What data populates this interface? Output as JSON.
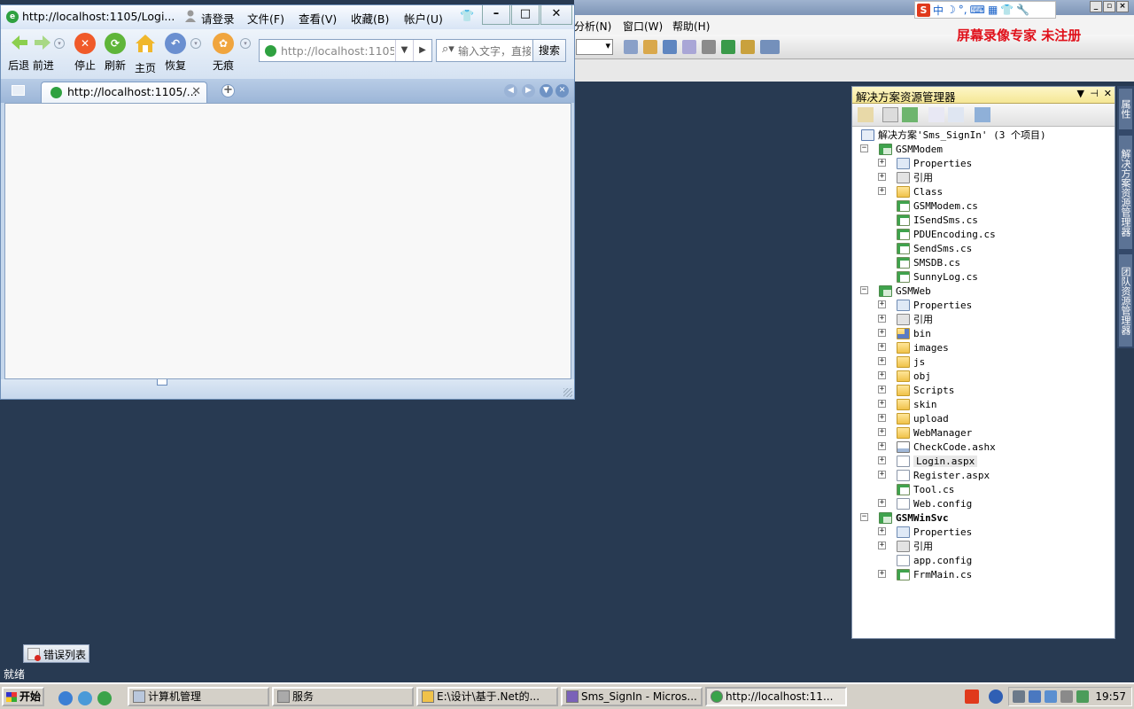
{
  "vs": {
    "menu": [
      "分析(N)",
      "窗口(W)",
      "帮助(H)"
    ],
    "status": "就绪",
    "error_tab": "错误列表"
  },
  "recorder_text": "屏幕录像专家  未注册",
  "ime_text": "中",
  "browser": {
    "title": "http://localhost:1105/Logi...",
    "login": "请登录",
    "menus": [
      "文件(F)",
      "查看(V)",
      "收藏(B)",
      "帐户(U)"
    ],
    "nav": {
      "back_fwd": "后退 前进",
      "stop": "停止",
      "refresh": "刷新",
      "home": "主页",
      "restore": "恢复",
      "incognito": "无痕"
    },
    "address_value": "http://localhost:1105",
    "search_placeholder": "输入文字，直接",
    "search_button": "搜索",
    "tab_title": "http://localhost:1105/..."
  },
  "solution_explorer": {
    "title": "解决方案资源管理器",
    "solution": "解决方案'Sms_SignIn' (3 个项目)",
    "items": [
      {
        "label": "GSMModem",
        "icon": "project-icon",
        "level": 0,
        "exp": "-"
      },
      {
        "label": "Properties",
        "icon": "properties-icon",
        "level": 1,
        "exp": "+"
      },
      {
        "label": "引用",
        "icon": "references-icon",
        "level": 1,
        "exp": "+"
      },
      {
        "label": "Class",
        "icon": "folder-icon",
        "level": 1,
        "exp": "+"
      },
      {
        "label": "GSMModem.cs",
        "icon": "cs-file-icon",
        "level": 1,
        "exp": ""
      },
      {
        "label": "ISendSms.cs",
        "icon": "cs-file-icon",
        "level": 1,
        "exp": ""
      },
      {
        "label": "PDUEncoding.cs",
        "icon": "cs-file-icon",
        "level": 1,
        "exp": ""
      },
      {
        "label": "SendSms.cs",
        "icon": "cs-file-icon",
        "level": 1,
        "exp": ""
      },
      {
        "label": "SMSDB.cs",
        "icon": "cs-file-icon",
        "level": 1,
        "exp": ""
      },
      {
        "label": "SunnyLog.cs",
        "icon": "cs-file-icon",
        "level": 1,
        "exp": ""
      },
      {
        "label": "GSMWeb",
        "icon": "web-project-icon",
        "level": 0,
        "exp": "-"
      },
      {
        "label": "Properties",
        "icon": "properties-icon",
        "level": 1,
        "exp": "+"
      },
      {
        "label": "引用",
        "icon": "references-icon",
        "level": 1,
        "exp": "+"
      },
      {
        "label": "bin",
        "icon": "bin-folder-icon",
        "level": 1,
        "exp": "+"
      },
      {
        "label": "images",
        "icon": "folder-icon",
        "level": 1,
        "exp": "+"
      },
      {
        "label": "js",
        "icon": "folder-icon",
        "level": 1,
        "exp": "+"
      },
      {
        "label": "obj",
        "icon": "folder-icon",
        "level": 1,
        "exp": "+"
      },
      {
        "label": "Scripts",
        "icon": "folder-icon",
        "level": 1,
        "exp": "+"
      },
      {
        "label": "skin",
        "icon": "folder-icon",
        "level": 1,
        "exp": "+"
      },
      {
        "label": "upload",
        "icon": "folder-icon",
        "level": 1,
        "exp": "+"
      },
      {
        "label": "WebManager",
        "icon": "folder-icon",
        "level": 1,
        "exp": "+"
      },
      {
        "label": "CheckCode.ashx",
        "icon": "handler-file-icon",
        "level": 1,
        "exp": "+"
      },
      {
        "label": "Login.aspx",
        "icon": "aspx-page-icon",
        "level": 1,
        "exp": "+",
        "selected": true
      },
      {
        "label": "Register.aspx",
        "icon": "aspx-page-icon",
        "level": 1,
        "exp": "+"
      },
      {
        "label": "Tool.cs",
        "icon": "cs-file-icon",
        "level": 1,
        "exp": ""
      },
      {
        "label": "Web.config",
        "icon": "config-file-icon",
        "level": 1,
        "exp": "+"
      },
      {
        "label": "GSMWinSvc",
        "icon": "project-icon",
        "level": 0,
        "exp": "-",
        "bold": true
      },
      {
        "label": "Properties",
        "icon": "properties-icon",
        "level": 1,
        "exp": "+"
      },
      {
        "label": "引用",
        "icon": "references-icon",
        "level": 1,
        "exp": "+"
      },
      {
        "label": "app.config",
        "icon": "config-file-icon",
        "level": 1,
        "exp": ""
      },
      {
        "label": "FrmMain.cs",
        "icon": "form-file-icon",
        "level": 1,
        "exp": "+"
      }
    ]
  },
  "side_tabs": [
    "属性",
    "解决方案资源管理器",
    "团队资源管理器"
  ],
  "taskbar": {
    "start": "开始",
    "tasks": [
      {
        "label": "计算机管理"
      },
      {
        "label": "服务"
      },
      {
        "label": "E:\\设计\\基于.Net的..."
      },
      {
        "label": "Sms_SignIn - Micros..."
      },
      {
        "label": "http://localhost:11..."
      }
    ],
    "clock": "19:57"
  }
}
